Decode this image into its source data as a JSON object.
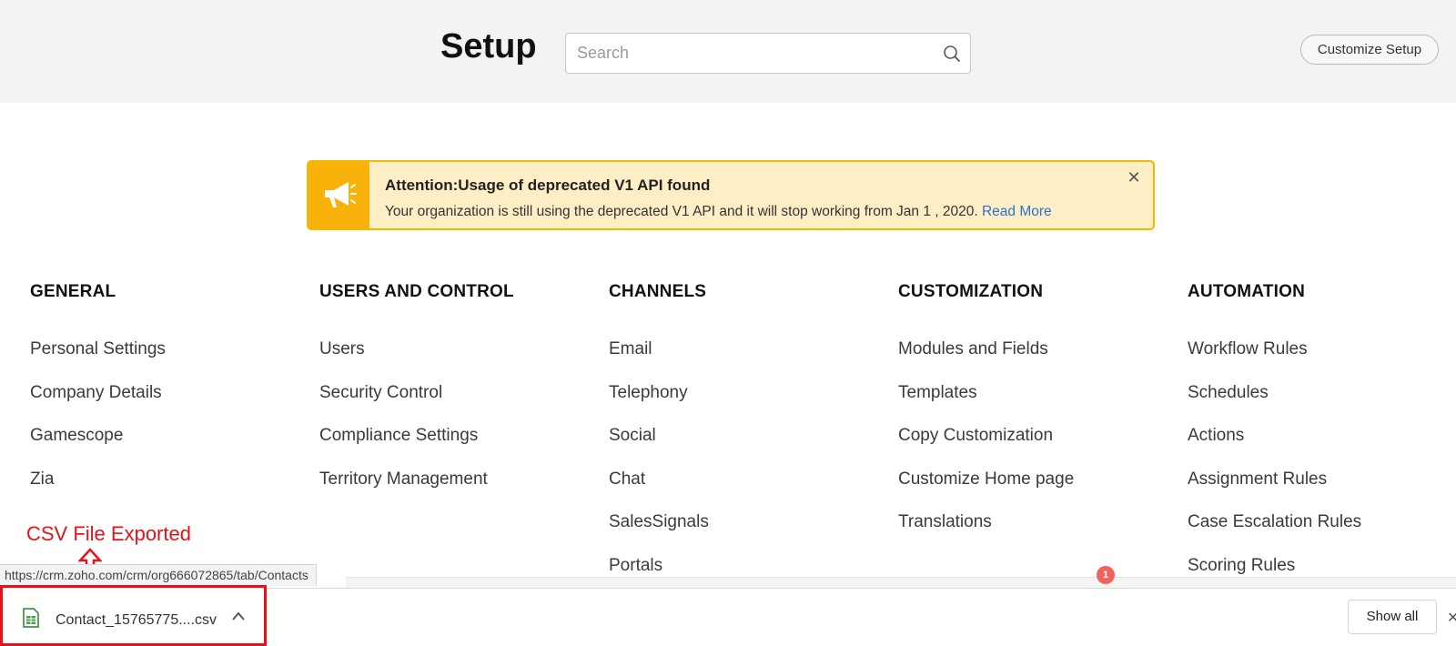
{
  "header": {
    "title": "Setup",
    "search_placeholder": "Search",
    "customize_label": "Customize Setup"
  },
  "alert": {
    "title": "Attention:Usage of deprecated V1 API found",
    "message": "Your organization is still using the deprecated V1 API and it will stop working from Jan 1 , 2020.",
    "link": "Read More",
    "accent_color": "#f9b20a"
  },
  "columns": [
    {
      "title": "GENERAL",
      "items": [
        "Personal Settings",
        "Company Details",
        "Gamescope",
        "Zia"
      ]
    },
    {
      "title": "USERS AND CONTROL",
      "items": [
        "Users",
        "Security Control",
        "Compliance Settings",
        "Territory Management"
      ]
    },
    {
      "title": "CHANNELS",
      "items": [
        "Email",
        "Telephony",
        "Social",
        "Chat",
        "SalesSignals",
        "Portals"
      ]
    },
    {
      "title": "CUSTOMIZATION",
      "items": [
        "Modules and Fields",
        "Templates",
        "Copy Customization",
        "Customize Home page",
        "Translations"
      ]
    },
    {
      "title": "AUTOMATION",
      "items": [
        "Workflow Rules",
        "Schedules",
        "Actions",
        "Assignment Rules",
        "Case Escalation Rules",
        "Scoring Rules"
      ]
    }
  ],
  "annotation": {
    "text": "CSV File Exported",
    "color": "#e6121a"
  },
  "status_bar": {
    "url": "https://crm.zoho.com/crm/org666072865/tab/Contacts",
    "badge_count": "1"
  },
  "download_bar": {
    "file_name": "Contact_15765775....csv",
    "file_icon": "spreadsheet-file-icon",
    "show_all_label": "Show all"
  }
}
